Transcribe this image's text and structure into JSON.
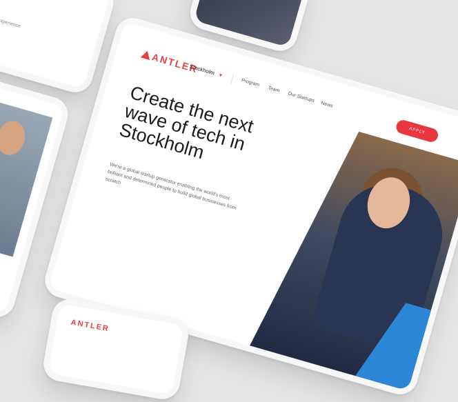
{
  "brand": {
    "logo_text": "ANTLER",
    "accent": "#e8373f"
  },
  "header": {
    "city": "Stockholm",
    "nav": [
      "Program",
      "Team",
      "Our Startups",
      "News"
    ],
    "apply": "APPLY"
  },
  "hero": {
    "headline": "Create the next wave of tech in Stockholm",
    "sub": "We're a global startup generator enabling the world's most brilliant and determined people to build global businesses from scratch"
  },
  "top_left_text": "and development experience\nin machine learning",
  "bottom_logo": "ANTLER"
}
